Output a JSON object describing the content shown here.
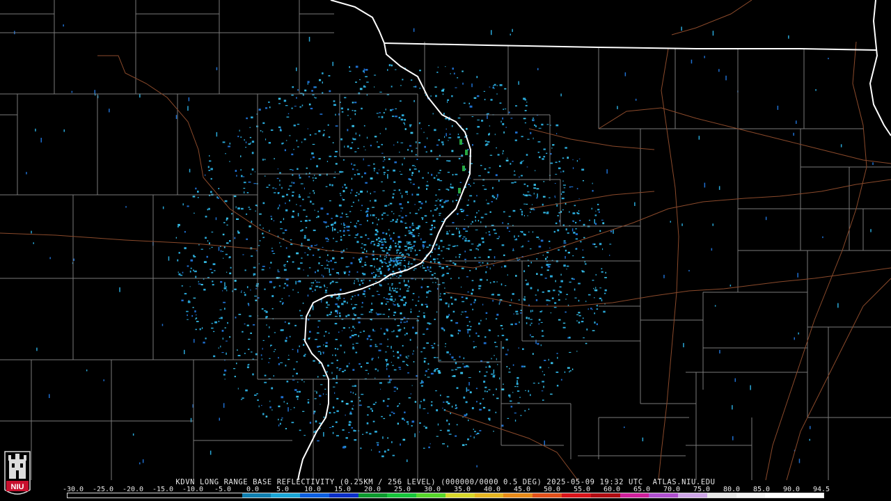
{
  "product": {
    "caption": "KDVN LONG RANGE BASE REFLECTIVITY (0.25KM / 256 LEVEL) (000000/0000 0.5 DEG) 2025-05-09 19:32 UTC  ATLAS.NIU.EDU"
  },
  "logo": {
    "text": "NIU",
    "color": "#c8102e"
  },
  "colors": {
    "background": "#000000",
    "county_lines": "#7a7a7a",
    "state_lines": "#ffffff",
    "rivers_roads": "#8b4a2b",
    "echo_light": "#2aa8d8",
    "echo_mid": "#1f6fd0",
    "echo_green": "#27a843"
  },
  "scale": {
    "ticks": [
      "-30.0",
      "-25.0",
      "-20.0",
      "-15.0",
      "-10.0",
      "-5.0",
      "0.0",
      "5.0",
      "10.0",
      "15.0",
      "20.0",
      "25.0",
      "30.0",
      "35.0",
      "40.0",
      "45.0",
      "50.0",
      "55.0",
      "60.0",
      "65.0",
      "70.0",
      "75.0",
      "80.0",
      "85.0",
      "90.0",
      "94.5"
    ],
    "colors": [
      "#000000",
      "#000000",
      "#000000",
      "#000000",
      "#000000",
      "#000000",
      "#0f7fb0",
      "#1aa6d6",
      "#0b5ee0",
      "#0a2fc8",
      "#0c9a2e",
      "#16c43a",
      "#56d62a",
      "#d7d82a",
      "#e6b520",
      "#e88a18",
      "#e2501a",
      "#d8141a",
      "#b00c12",
      "#cf1f9a",
      "#b04fd0",
      "#cfa6e8",
      "#e8e8e8",
      "#f4f4f4",
      "#ffffff",
      "#ffffff"
    ]
  }
}
